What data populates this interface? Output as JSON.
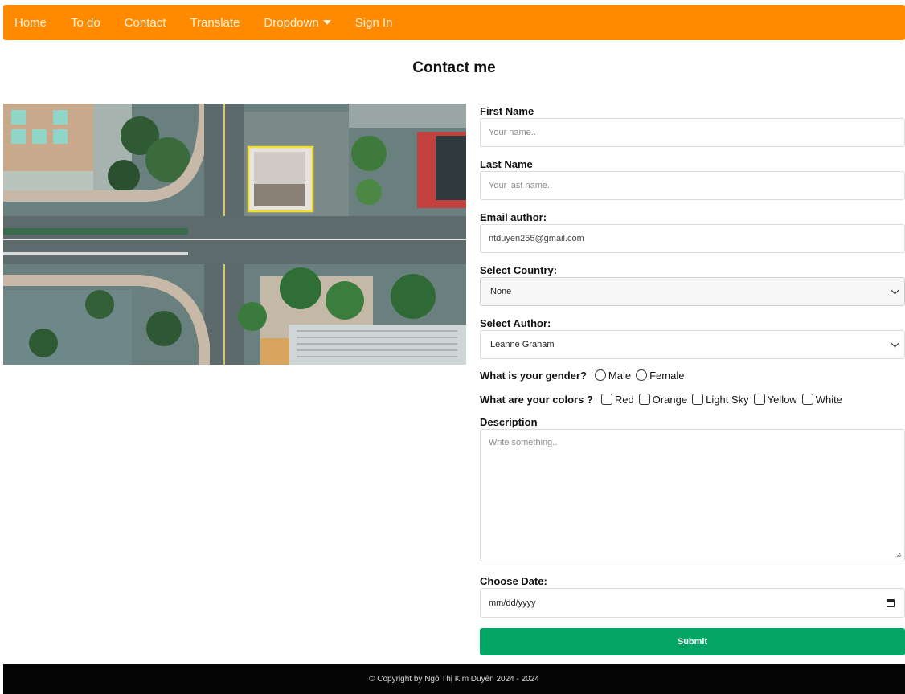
{
  "nav": {
    "items": [
      "Home",
      "To do",
      "Contact",
      "Translate",
      "Dropdown",
      "Sign In"
    ]
  },
  "page": {
    "title": "Contact me"
  },
  "form": {
    "first_name_label": "First Name",
    "first_name_placeholder": "Your name..",
    "last_name_label": "Last Name",
    "last_name_placeholder": "Your last name..",
    "email_label": "Email author:",
    "email_value": "ntduyen255@gmail.com",
    "country_label": "Select Country:",
    "country_value": "None",
    "author_label": "Select Author:",
    "author_value": "Leanne Graham",
    "gender_question": "What is your gender?",
    "gender_options": [
      "Male",
      "Female"
    ],
    "colors_question": "What are your colors ?",
    "color_options": [
      "Red",
      "Orange",
      "Light Sky",
      "Yellow",
      "White"
    ],
    "description_label": "Description",
    "description_placeholder": "Write something..",
    "date_label": "Choose Date:",
    "date_value": "mm/dd/yyyy",
    "submit_label": "Submit"
  },
  "footer": {
    "text": "© Copyright by Ngô Thị Kim Duyên 2024 - 2024"
  },
  "colors": {
    "nav": "#ff8a00",
    "submit": "#04a565",
    "footer": "#050505"
  }
}
